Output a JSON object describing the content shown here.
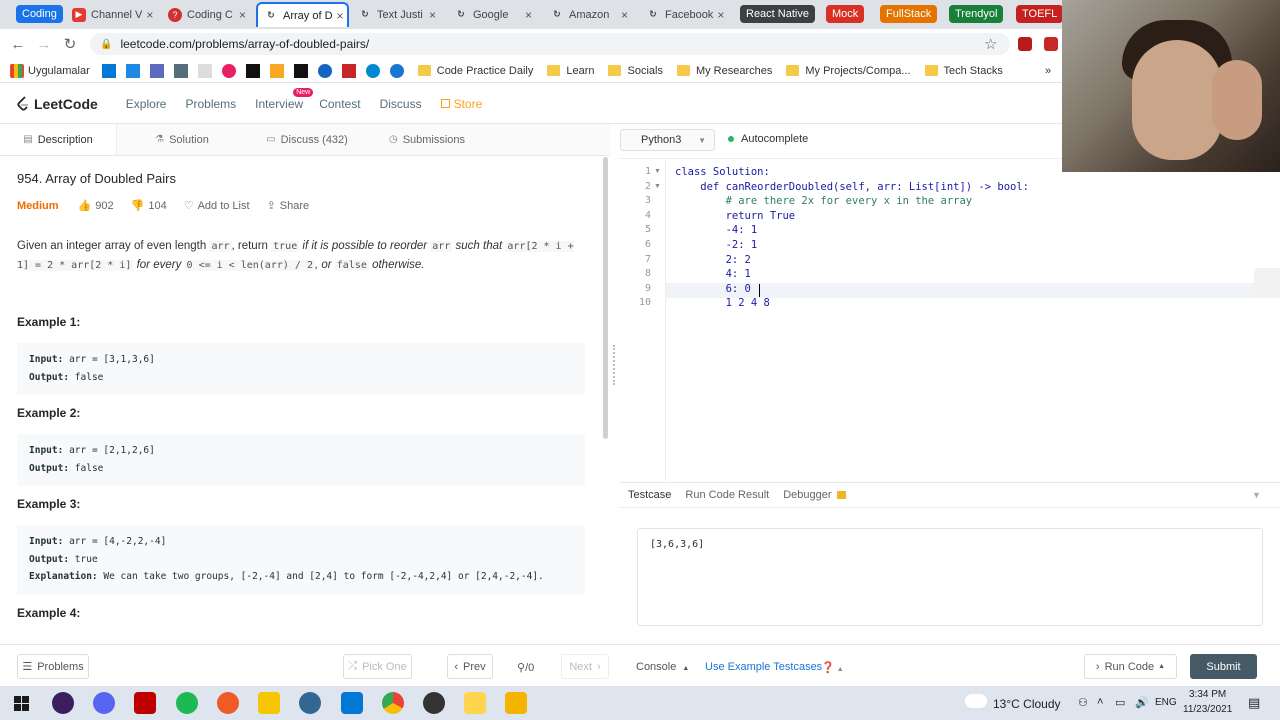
{
  "browser": {
    "tabs": [
      {
        "label": "Coding",
        "kind": "group",
        "color": "#1a73e8"
      },
      {
        "label": "Channel V",
        "icon": "youtube-icon",
        "color": "#e53935"
      },
      {
        "label": "Coding C",
        "icon": "question-icon",
        "color": "#d32f2f"
      },
      {
        "label": "Array of D",
        "icon": "leetcode-icon",
        "color": "#444",
        "active": true
      },
      {
        "label": "Text Justi",
        "icon": "leetcode-icon",
        "color": "#444"
      },
      {
        "label": "Google",
        "icon": "leetcode-icon",
        "color": "#444"
      },
      {
        "label": "Amazon",
        "icon": "leetcode-icon",
        "color": "#444"
      },
      {
        "label": "Facebook",
        "icon": "leetcode-icon",
        "color": "#444"
      }
    ],
    "tab_groups": [
      {
        "label": "React Native",
        "color": "#3c4043"
      },
      {
        "label": "Mock",
        "color": "#d93025"
      },
      {
        "label": "FullStack",
        "color": "#e37400"
      },
      {
        "label": "Trendyol",
        "color": "#188038"
      },
      {
        "label": "TOEFL",
        "color": "#c5221f"
      }
    ],
    "url": "leetcode.com/problems/array-of-doubled-pairs/",
    "bookmarks": [
      {
        "label": "Uygulamalar",
        "type": "apps"
      },
      {
        "label": "Code Practice Daily",
        "type": "folder"
      },
      {
        "label": "Learn",
        "type": "folder"
      },
      {
        "label": "Socials",
        "type": "folder"
      },
      {
        "label": "My Researches",
        "type": "folder"
      },
      {
        "label": "My Projects/Compa...",
        "type": "folder"
      },
      {
        "label": "Tech Stacks",
        "type": "folder"
      }
    ],
    "bookmark_overflow": "»"
  },
  "nav": {
    "logo": "LeetCode",
    "links": [
      "Explore",
      "Problems",
      "Interview",
      "Contest",
      "Discuss"
    ],
    "new_badge": "New",
    "store": "Store"
  },
  "left_tabs": [
    "Description",
    "Solution",
    "Discuss (432)",
    "Submissions"
  ],
  "problem": {
    "title": "954. Array of Doubled Pairs",
    "difficulty": "Medium",
    "likes": "902",
    "dislikes": "104",
    "add_to_list": "Add to List",
    "share": "Share",
    "prompt": {
      "p1": "Given an integer array of even length ",
      "c1": "arr",
      "p2": ", return ",
      "c2": "true",
      "p3": " if it is possible to reorder ",
      "c3": "arr",
      "p4": " such that ",
      "c4": "arr[2 * i + 1] = 2 * arr[2 * i]",
      "p5": " for every ",
      "c5": "0 <= i < len(arr) / 2",
      "p6": ", or ",
      "c6": "false",
      "p7": " otherwise."
    },
    "examples": [
      {
        "title": "Example 1:",
        "input": "arr = [3,1,3,6]",
        "output": "false"
      },
      {
        "title": "Example 2:",
        "input": "arr = [2,1,2,6]",
        "output": "false"
      },
      {
        "title": "Example 3:",
        "input": "arr = [4,-2,2,-4]",
        "output": "true",
        "explanation": "We can take two groups, [-2,-4] and [2,4] to form [-2,-4,2,4] or [2,4,-2,-4]."
      },
      {
        "title": "Example 4:"
      }
    ],
    "labels": {
      "input": "Input:",
      "output": "Output:",
      "explanation": "Explanation:"
    }
  },
  "editor": {
    "language": "Python3",
    "autocomplete": "Autocomplete",
    "lines": [
      "class Solution:",
      "    def canReorderDoubled(self, arr: List[int]) -> bool:",
      "        # are there 2x for every x in the array",
      "        return True",
      "        -4: 1",
      "        -2: 1",
      "        2: 2",
      "        4: 1",
      "        6: 0",
      "        1 2 4 8"
    ]
  },
  "console": {
    "tabs": [
      "Testcase",
      "Run Code Result",
      "Debugger"
    ],
    "testcase": "[3,6,3,6]"
  },
  "bottom": {
    "problems": "Problems",
    "pick_one": "Pick One",
    "prev": "Prev",
    "progress": "/0",
    "next": "Next",
    "console": "Console",
    "use_example": "Use Example Testcases",
    "run_code": "Run Code",
    "submit": "Submit"
  },
  "taskbar": {
    "weather": "13°C  Cloudy",
    "lang": "ENG",
    "time": "3:34 PM",
    "date": "11/23/2021"
  }
}
